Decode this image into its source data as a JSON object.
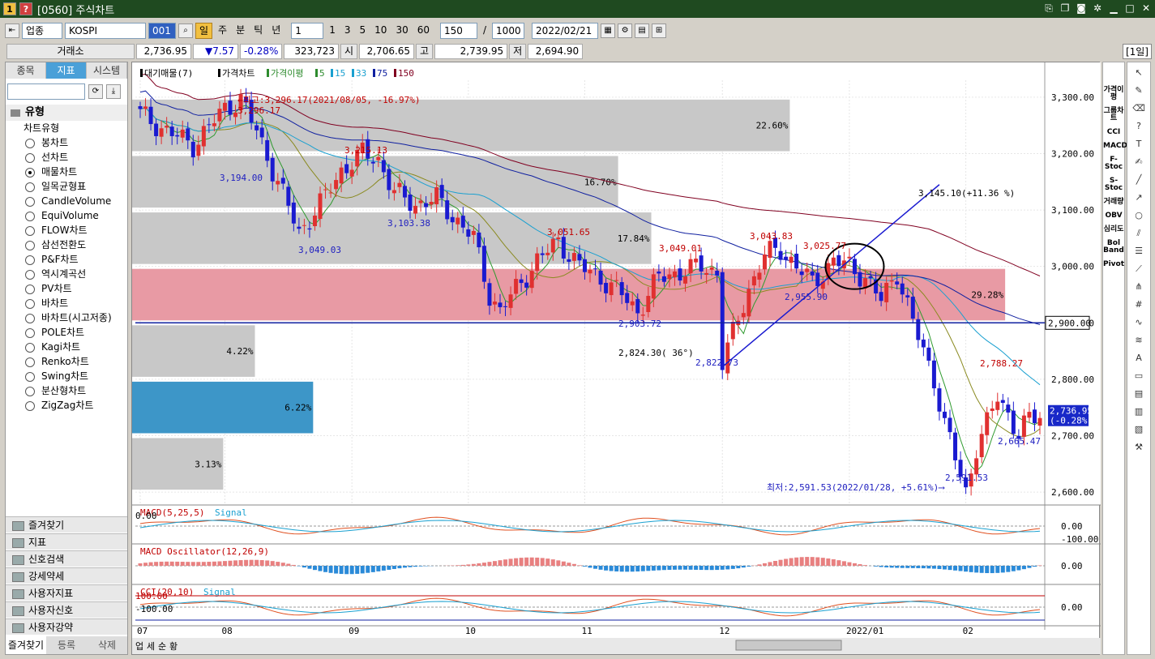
{
  "window": {
    "badge1": "1",
    "badge2": "?",
    "title": "[0560] 주식차트"
  },
  "toolbar": {
    "category": "업종",
    "symbol": "KOSPI",
    "code": "001",
    "periods": [
      "일",
      "주",
      "분",
      "틱",
      "년"
    ],
    "interval": "1",
    "intervals": [
      "1",
      "3",
      "5",
      "10",
      "30",
      "60"
    ],
    "count": "150",
    "total": "1000",
    "date": "2022/02/21"
  },
  "quote": {
    "exchange": "거래소",
    "price": "2,736.95",
    "change": "▼7.57",
    "pct": "-0.28%",
    "volume": "323,723",
    "open_label": "시",
    "open": "2,706.65",
    "high_label": "고",
    "high": "2,739.95",
    "low_label": "저",
    "low": "2,694.90",
    "mode": "[1일]"
  },
  "left": {
    "tabs": [
      "종목",
      "지표",
      "시스템"
    ],
    "section": "유형",
    "node": "차트유형",
    "items": [
      "봉차트",
      "선차트",
      "매물차트",
      "일목균형표",
      "CandleVolume",
      "EquiVolume",
      "FLOW차트",
      "삼선전환도",
      "P&F차트",
      "역시계곡선",
      "PV차트",
      "바차트",
      "바차트(시고저종)",
      "POLE차트",
      "Kagi차트",
      "Renko차트",
      "Swing차트",
      "분산형차트",
      "ZigZag차트"
    ],
    "selected": 2,
    "folders": [
      "즐겨찾기",
      "지표",
      "신호검색",
      "강세약세",
      "사용자지표",
      "사용자신호",
      "사용자강약"
    ],
    "bottom_tabs": [
      "즐겨찾기",
      "등록",
      "삭제"
    ]
  },
  "right_tools": [
    "가격이평",
    "그룹차트",
    "CCI",
    "MACD",
    "F-Stoc",
    "S-Stoc",
    "거래량",
    "OBV",
    "심리도",
    "Bol Band",
    "Pivot"
  ],
  "chart_data": {
    "type": "candlestick",
    "legend": [
      "대기매물(7)",
      "가격차트",
      "가격이평",
      "5",
      "15",
      "33",
      "75",
      "150"
    ],
    "legend_colors": [
      "#000000",
      "#000000",
      "#2e8b2e",
      "#2e8b2e",
      "#1aa0d0",
      "#1aa0d0",
      "#1020a0",
      "#800020"
    ],
    "ylim": [
      2580,
      3330
    ],
    "yticks": [
      "3,300.00",
      "3,200.00",
      "3,100.00",
      "3,000.00",
      "2,900.00",
      "2,800.00",
      "2,700.00",
      "2,600.00"
    ],
    "ytick_values": [
      3300,
      3200,
      3100,
      3000,
      2900,
      2800,
      2700,
      2600
    ],
    "xticks": [
      "07",
      "08",
      "09",
      "10",
      "11",
      "12",
      "2022/01",
      "02"
    ],
    "xtick_index": [
      0,
      16,
      40,
      62,
      84,
      110,
      134,
      156
    ],
    "n_days": 171,
    "volume_profile": [
      {
        "low": 3200,
        "high": 3300,
        "pct": "22.60%",
        "value": 22.6
      },
      {
        "low": 3100,
        "high": 3200,
        "pct": "16.70%",
        "value": 16.7
      },
      {
        "low": 3000,
        "high": 3100,
        "pct": "17.84%",
        "value": 17.84
      },
      {
        "low": 2900,
        "high": 3000,
        "pct": "29.28%",
        "value": 29.28,
        "highlight": "pink"
      },
      {
        "low": 2800,
        "high": 2900,
        "pct": "4.22%",
        "value": 4.22
      },
      {
        "low": 2700,
        "high": 2800,
        "pct": "6.22%",
        "value": 6.22,
        "highlight": "blue"
      },
      {
        "low": 2600,
        "high": 2700,
        "pct": "3.13%",
        "value": 3.13
      }
    ],
    "closes_anchor": [
      [
        0,
        3270
      ],
      [
        5,
        3240
      ],
      [
        10,
        3215
      ],
      [
        16,
        3280
      ],
      [
        19,
        3296
      ],
      [
        22,
        3240
      ],
      [
        26,
        3150
      ],
      [
        30,
        3060
      ],
      [
        34,
        3110
      ],
      [
        38,
        3170
      ],
      [
        42,
        3200
      ],
      [
        45,
        3190
      ],
      [
        48,
        3130
      ],
      [
        52,
        3110
      ],
      [
        56,
        3120
      ],
      [
        60,
        3080
      ],
      [
        63,
        3050
      ],
      [
        66,
        2950
      ],
      [
        68,
        2920
      ],
      [
        71,
        2960
      ],
      [
        75,
        3010
      ],
      [
        79,
        3045
      ],
      [
        83,
        3000
      ],
      [
        87,
        2980
      ],
      [
        91,
        2950
      ],
      [
        94,
        2920
      ],
      [
        98,
        2980
      ],
      [
        102,
        2990
      ],
      [
        106,
        3000
      ],
      [
        109,
        2990
      ],
      [
        110,
        2830
      ],
      [
        112,
        2880
      ],
      [
        115,
        2960
      ],
      [
        118,
        3020
      ],
      [
        121,
        3030
      ],
      [
        124,
        3000
      ],
      [
        127,
        2970
      ],
      [
        131,
        3010
      ],
      [
        134,
        3000
      ],
      [
        137,
        2980
      ],
      [
        140,
        2940
      ],
      [
        143,
        2990
      ],
      [
        146,
        2900
      ],
      [
        148,
        2850
      ],
      [
        150,
        2800
      ],
      [
        152,
        2720
      ],
      [
        154,
        2660
      ],
      [
        156,
        2600
      ],
      [
        158,
        2680
      ],
      [
        160,
        2720
      ],
      [
        162,
        2770
      ],
      [
        164,
        2740
      ],
      [
        166,
        2700
      ],
      [
        168,
        2730
      ],
      [
        170,
        2737
      ]
    ],
    "ma_last": [
      {
        "name": "5",
        "value": 2720
      },
      {
        "name": "15",
        "value": 2725
      },
      {
        "name": "33",
        "value": 2815
      },
      {
        "name": "75",
        "value": 2905
      },
      {
        "name": "150",
        "value": 3015
      }
    ],
    "annotations": [
      {
        "text": "←최고:3,296.17(2021/08/05, -16.97%)",
        "color": "#c00000"
      },
      {
        "text": "3,296.17",
        "color": "#c00000"
      },
      {
        "text": "3,194.00",
        "color": "#2020c0"
      },
      {
        "text": "3,215.13",
        "color": "#c00000"
      },
      {
        "text": "3,049.03",
        "color": "#2020c0"
      },
      {
        "text": "3,103.38",
        "color": "#2020c0"
      },
      {
        "text": "3,051.65",
        "color": "#c00000"
      },
      {
        "text": "3,049.01",
        "color": "#c00000"
      },
      {
        "text": "3,043.83",
        "color": "#c00000"
      },
      {
        "text": "3,025.77",
        "color": "#c00000"
      },
      {
        "text": "2,955.90",
        "color": "#2020c0"
      },
      {
        "text": "2,903.72",
        "color": "#2020c0"
      },
      {
        "text": "2,824.30( 36°)",
        "color": "#000000"
      },
      {
        "text": "2,822.73",
        "color": "#2020c0"
      },
      {
        "text": "3,145.10(+11.36 %)",
        "color": "#000000"
      },
      {
        "text": "2,788.27",
        "color": "#c00000"
      },
      {
        "text": "2,665.47",
        "color": "#2020c0"
      },
      {
        "text": "2,591.53",
        "color": "#2020c0"
      },
      {
        "text": "최저:2,591.53(2022/01/28, +5.61%)⟶",
        "color": "#2020c0"
      }
    ],
    "hline_label": "2,900.00",
    "last_label": [
      "2,736.95",
      "(-0.28%)"
    ],
    "indicators": [
      {
        "name": "MACD(5,25,5)",
        "signal": "Signal",
        "zero": "0.00",
        "ticks": [
          "0.00",
          "-100.00"
        ]
      },
      {
        "name": "MACD Oscillator(12,26,9)",
        "ticks": [
          "0.00"
        ]
      },
      {
        "name": "CCI(20,10)",
        "signal": "Signal",
        "top": "100.00",
        "bottom": "-100.00",
        "ticks": [
          "0.00"
        ]
      }
    ]
  },
  "bottom_bar": {
    "labels": [
      "업",
      "세",
      "순",
      "황"
    ]
  }
}
